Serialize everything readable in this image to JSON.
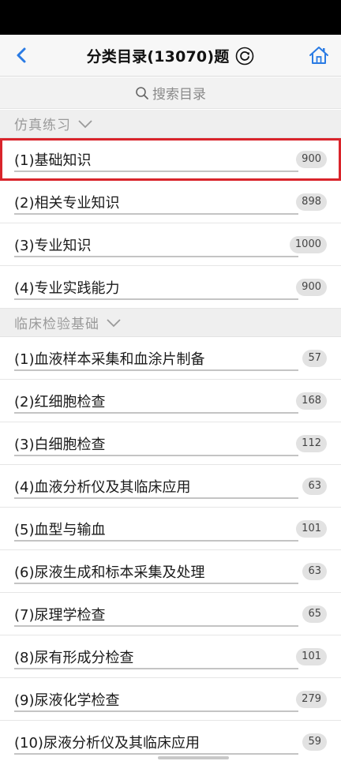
{
  "nav": {
    "title": "分类目录(13070)题"
  },
  "search": {
    "placeholder": "搜索目录"
  },
  "sections": [
    {
      "title": "仿真练习",
      "items": [
        {
          "label": "(1)基础知识",
          "count": "900",
          "selected": true
        },
        {
          "label": "(2)相关专业知识",
          "count": "898"
        },
        {
          "label": "(3)专业知识",
          "count": "1000"
        },
        {
          "label": "(4)专业实践能力",
          "count": "900"
        }
      ]
    },
    {
      "title": "临床检验基础",
      "items": [
        {
          "label": "(1)血液样本采集和血涂片制备",
          "count": "57"
        },
        {
          "label": "(2)红细胞检查",
          "count": "168"
        },
        {
          "label": "(3)白细胞检查",
          "count": "112"
        },
        {
          "label": "(4)血液分析仪及其临床应用",
          "count": "63"
        },
        {
          "label": "(5)血型与输血",
          "count": "101"
        },
        {
          "label": "(6)尿液生成和标本采集及处理",
          "count": "63"
        },
        {
          "label": "(7)尿理学检查",
          "count": "65"
        },
        {
          "label": "(8)尿有形成分检查",
          "count": "101"
        },
        {
          "label": "(9)尿液化学检查",
          "count": "279"
        },
        {
          "label": "(10)尿液分析仪及其临床应用",
          "count": "59"
        }
      ]
    }
  ],
  "colors": {
    "accent": "#2a7be4",
    "selected_outline": "#d9242b"
  },
  "icons": {
    "back": "chevron-left-icon",
    "refresh": "refresh-icon",
    "home": "home-icon",
    "search": "search-icon",
    "section_toggle": "chevron-down-icon"
  }
}
